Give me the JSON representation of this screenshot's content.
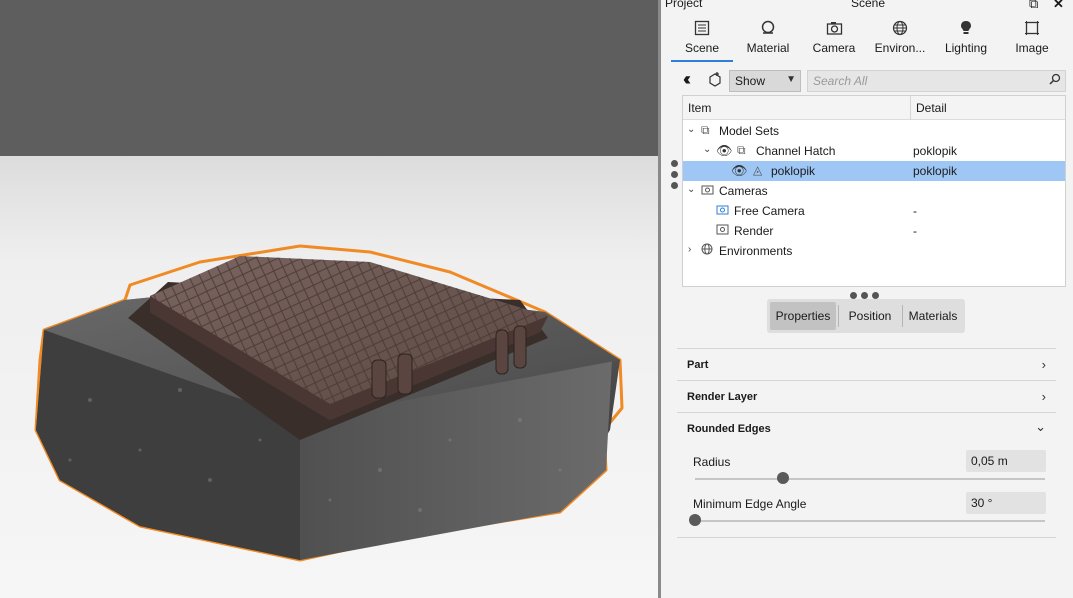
{
  "panel_header": {
    "project_label": "Project",
    "scene_label": "Scene",
    "restore_glyph": "⧉",
    "close_glyph": "✕"
  },
  "tabs": [
    {
      "label": "Scene",
      "icon": "scene-list-icon"
    },
    {
      "label": "Material",
      "icon": "material-icon"
    },
    {
      "label": "Camera",
      "icon": "camera-icon"
    },
    {
      "label": "Environ...",
      "icon": "globe-icon"
    },
    {
      "label": "Lighting",
      "icon": "bulb-icon"
    },
    {
      "label": "Image",
      "icon": "frame-icon"
    }
  ],
  "active_tab": "Scene",
  "filter": {
    "dropdown_value": "Show",
    "search_placeholder": "Search All"
  },
  "tree": {
    "columns": {
      "item": "Item",
      "detail": "Detail"
    },
    "rows": [
      {
        "label": "Model Sets",
        "detail": ""
      },
      {
        "label": "Channel Hatch",
        "detail": "poklopik"
      },
      {
        "label": "poklopik",
        "detail": "poklopik",
        "selected": true
      },
      {
        "label": "Cameras",
        "detail": ""
      },
      {
        "label": "Free Camera",
        "detail": "-"
      },
      {
        "label": "Render",
        "detail": "-"
      },
      {
        "label": "Environments",
        "detail": ""
      }
    ]
  },
  "subtabs": [
    "Properties",
    "Position",
    "Materials"
  ],
  "active_subtab": "Properties",
  "sections": [
    {
      "title": "Part",
      "expanded": false
    },
    {
      "title": "Render Layer",
      "expanded": false
    },
    {
      "title": "Rounded Edges",
      "expanded": true
    }
  ],
  "properties": {
    "radius": {
      "label": "Radius",
      "value": "0,05 m",
      "slider_fraction": 0.25
    },
    "min_edge_angle": {
      "label": "Minimum Edge Angle",
      "value": "30 °",
      "slider_fraction": 0.0
    }
  },
  "colors": {
    "accent": "#2d7fd8",
    "selection": "#9fc7f5",
    "outline": "#f08a24"
  }
}
